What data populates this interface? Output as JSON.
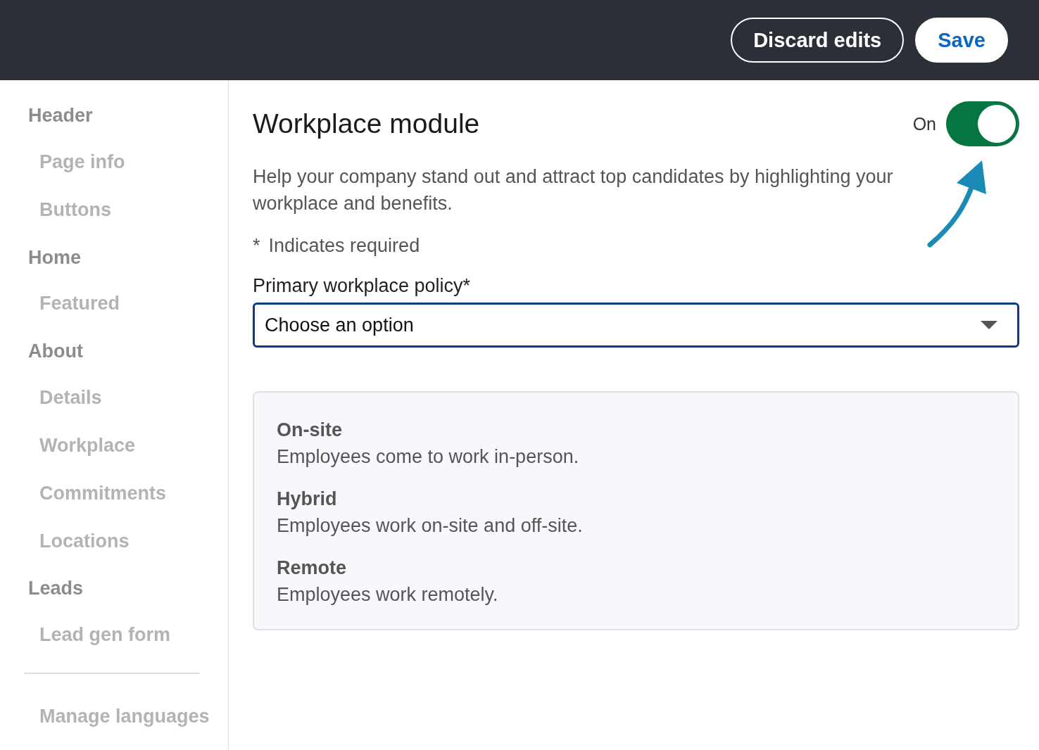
{
  "top_bar": {
    "buttons": [
      {
        "label": "Discard edits",
        "kind": "secondary"
      },
      {
        "label": "Save",
        "kind": "primary"
      }
    ]
  },
  "sidebar": {
    "items": [
      {
        "label": "Header",
        "children": [
          {
            "label": "Page info"
          },
          {
            "label": "Buttons"
          }
        ]
      },
      {
        "label": "Home",
        "children": [
          {
            "label": "Featured"
          }
        ]
      },
      {
        "label": "About",
        "children": [
          {
            "label": "Details"
          },
          {
            "label": "Workplace"
          },
          {
            "label": "Commitments"
          },
          {
            "label": "Locations"
          }
        ]
      },
      {
        "label": "Leads",
        "children": [
          {
            "label": "Lead gen form"
          }
        ]
      }
    ],
    "footer_items": [
      {
        "label": "Manage languages"
      }
    ]
  },
  "module": {
    "title": "Workplace module",
    "toggle": {
      "label": "On",
      "on": true
    },
    "description": "Help your company stand out and attract top candidates by highlighting your workplace and benefits.",
    "required_note": {
      "mark": "*",
      "text": "Indicates required"
    },
    "field": {
      "label": "Primary workplace policy*",
      "value": "Choose an option"
    },
    "options": [
      {
        "title": "On-site",
        "description": "Employees come to work in-person."
      },
      {
        "title": "Hybrid",
        "description": "Employees work on-site and off-site."
      },
      {
        "title": "Remote",
        "description": "Employees work remotely."
      }
    ]
  }
}
